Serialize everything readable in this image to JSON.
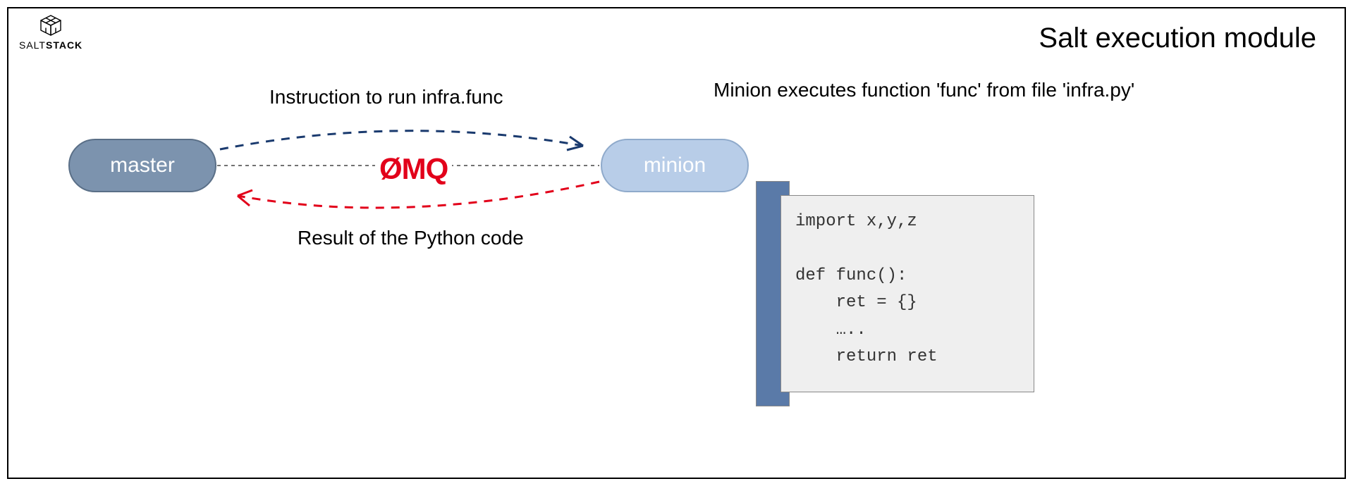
{
  "logo": {
    "thin": "SALT",
    "bold": "STACK"
  },
  "title": "Salt execution module",
  "nodes": {
    "master": "master",
    "minion": "minion"
  },
  "labels": {
    "instruction": "Instruction to run infra.func",
    "result": "Result of the Python code",
    "minion_exec": "Minion executes function 'func' from file 'infra.py'"
  },
  "zmq": "ØMQ",
  "code": "import x,y,z\n\ndef func():\n    ret = {}\n    …..\n    return ret"
}
